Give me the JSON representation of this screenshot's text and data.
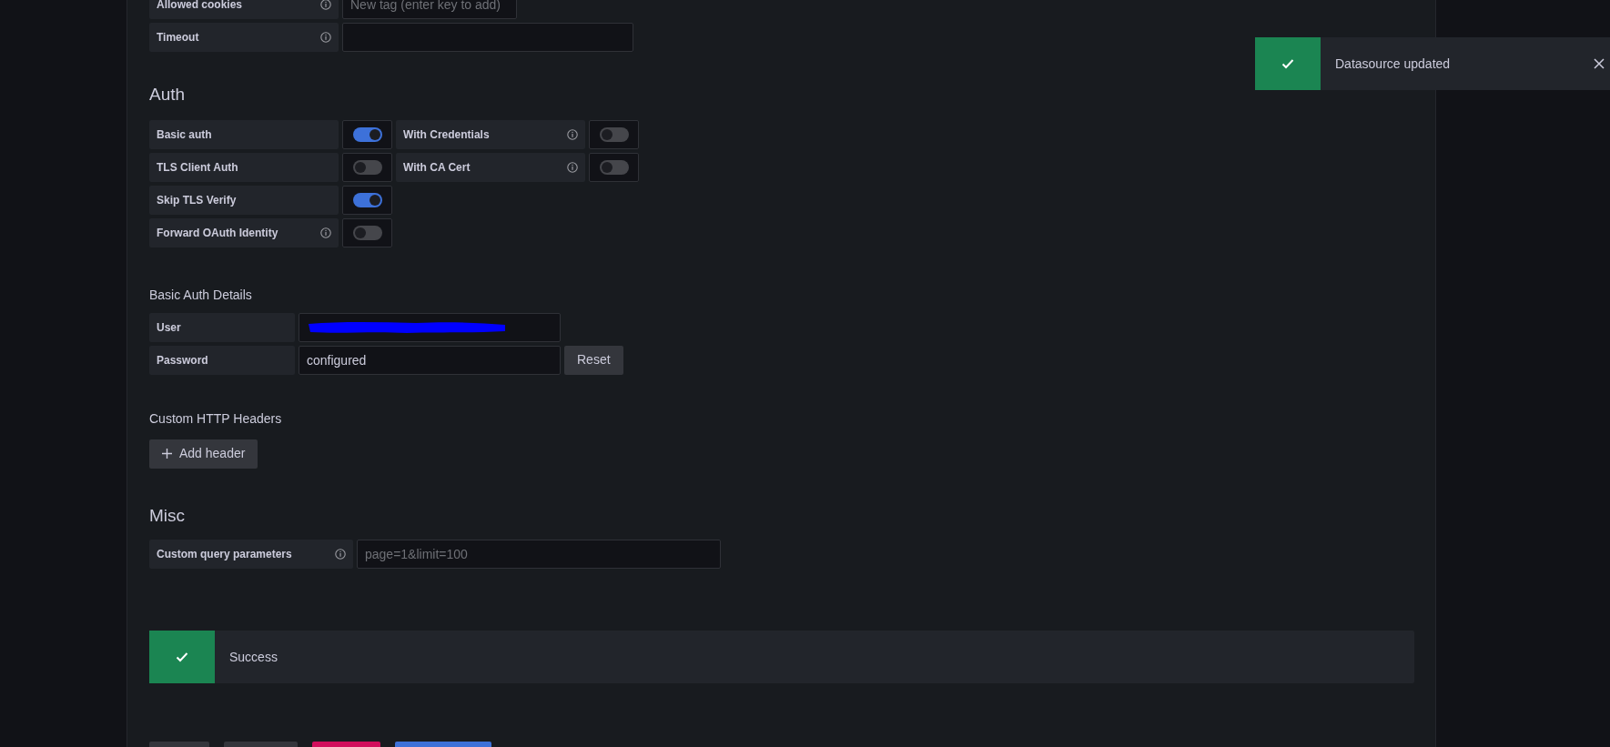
{
  "connection_fields": [
    {
      "label": "Allowed cookies",
      "info": true,
      "placeholder": "New tag (enter key to add)"
    },
    {
      "label": "Timeout",
      "info": true
    }
  ],
  "auth": {
    "title": "Auth",
    "rows": [
      [
        {
          "label": "Basic auth",
          "info": false,
          "on": true
        },
        {
          "label": "With Credentials",
          "info": true,
          "on": false
        }
      ],
      [
        {
          "label": "TLS Client Auth",
          "info": false,
          "on": false
        },
        {
          "label": "With CA Cert",
          "info": true,
          "on": false
        }
      ],
      [
        {
          "label": "Skip TLS Verify",
          "info": false,
          "on": true
        }
      ],
      [
        {
          "label": "Forward OAuth Identity",
          "info": true,
          "on": false
        }
      ]
    ]
  },
  "basic_auth_details": {
    "title": "Basic Auth Details",
    "fields": [
      {
        "label": "User",
        "redacted": true
      },
      {
        "label": "Password",
        "value": "configured",
        "reset_button": "Reset"
      }
    ]
  },
  "custom_headers": {
    "title": "Custom HTTP Headers",
    "add_button": "Add header"
  },
  "misc": {
    "title": "Misc",
    "fields": [
      {
        "label": "Custom query parameters",
        "info": true,
        "placeholder": "page=1&limit=100"
      }
    ]
  },
  "alert": {
    "text": "Success"
  },
  "footer_buttons": [
    {
      "kind": "secondary"
    },
    {
      "kind": "secondary"
    },
    {
      "kind": "destructive"
    },
    {
      "kind": "primary"
    }
  ],
  "toast": {
    "text": "Datasource updated"
  }
}
